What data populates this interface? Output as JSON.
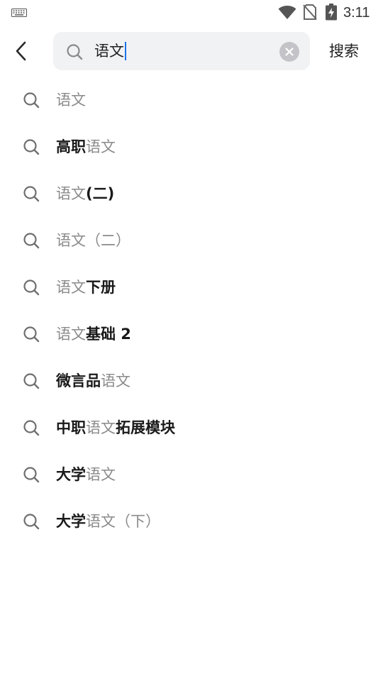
{
  "status_bar": {
    "time": "3:11",
    "icons": [
      "keyboard-icon",
      "wifi-icon",
      "no-sim-icon",
      "battery-charging-icon"
    ]
  },
  "header": {
    "back_icon": "chevron-left-icon",
    "search": {
      "icon": "search-icon",
      "value": "语文",
      "clear_icon": "close-icon"
    },
    "search_button_label": "搜索"
  },
  "suggestions": [
    {
      "segments": [
        {
          "text": "语文",
          "match": true
        }
      ]
    },
    {
      "segments": [
        {
          "text": "高职",
          "match": false
        },
        {
          "text": "语文",
          "match": true
        }
      ]
    },
    {
      "segments": [
        {
          "text": "语文",
          "match": true
        },
        {
          "text": "(二)",
          "match": false
        }
      ]
    },
    {
      "segments": [
        {
          "text": "语文（二）",
          "match": true
        }
      ]
    },
    {
      "segments": [
        {
          "text": "语文",
          "match": true
        },
        {
          "text": "下册",
          "match": false
        }
      ]
    },
    {
      "segments": [
        {
          "text": "语文",
          "match": true
        },
        {
          "text": "基础 2",
          "match": false
        }
      ]
    },
    {
      "segments": [
        {
          "text": "微言品",
          "match": false
        },
        {
          "text": "语文",
          "match": true
        }
      ]
    },
    {
      "segments": [
        {
          "text": "中职",
          "match": false
        },
        {
          "text": "语文",
          "match": true
        },
        {
          "text": "拓展模块",
          "match": false
        }
      ]
    },
    {
      "segments": [
        {
          "text": "大学",
          "match": false
        },
        {
          "text": "语文",
          "match": true
        }
      ]
    },
    {
      "segments": [
        {
          "text": "大学",
          "match": false
        },
        {
          "text": "语文（下）",
          "match": true
        }
      ]
    }
  ],
  "colors": {
    "match_text": "#8a8a8a",
    "plain_text": "#1a1a1a",
    "search_bg": "#f1f2f4",
    "caret": "#1a73e8"
  }
}
